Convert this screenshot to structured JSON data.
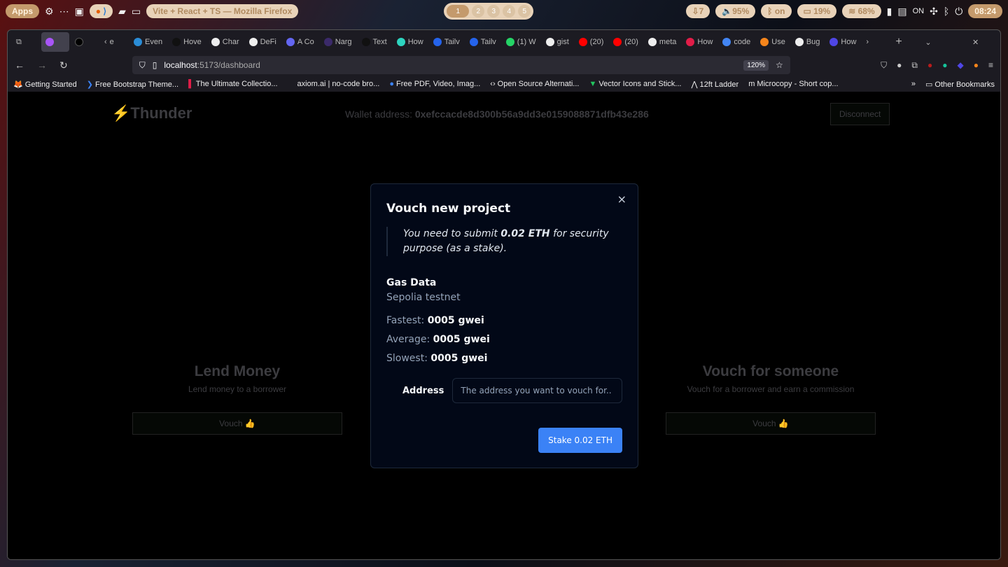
{
  "os": {
    "apps": "Apps",
    "window_title": "Vite + React + TS — Mozilla Firefox",
    "workspaces": [
      "1",
      "2",
      "3",
      "4",
      "5"
    ],
    "updates": "7",
    "volume": "95%",
    "bluetooth": "on",
    "battery": "19%",
    "wifi": "68%",
    "status_on": "ON",
    "clock": "08:24"
  },
  "browser": {
    "tabs": [
      "",
      "",
      "e",
      "Even",
      "Hove",
      "Char",
      "DeFi",
      "A Co",
      "Narg",
      "Text",
      "How",
      "Tailv",
      "Tailv",
      "(1) W",
      "gist",
      "(20)",
      "(20)",
      "meta",
      "How",
      "code",
      "Use",
      "Bug",
      "How"
    ],
    "url_host": "localhost",
    "url_path": ":5173/dashboard",
    "zoom": "120%",
    "bookmarks": [
      "Getting Started",
      "Free Bootstrap Theme...",
      "The Ultimate Collectio...",
      "axiom.ai | no-code bro...",
      "Free PDF, Video, Imag...",
      "Open Source Alternati...",
      "Vector Icons and Stick...",
      "12ft Ladder",
      "Microcopy - Short cop..."
    ],
    "other_bookmarks": "Other Bookmarks"
  },
  "app": {
    "logo": "Thunder",
    "wallet_label": "Wallet address:",
    "wallet": "0xefccacde8d300b56a9dd3e0159088871dfb43e286",
    "disconnect": "Disconnect",
    "cards": [
      {
        "title": "Lend Money",
        "desc": "Lend money to a borrower",
        "button": "Vouch 👍"
      },
      {
        "title": "Vouch for someone",
        "desc": "Vouch for a borrower and earn a commission",
        "button": "Vouch 👍"
      }
    ]
  },
  "modal": {
    "title": "Vouch new project",
    "note_pre": "You need to submit ",
    "note_bold": "0.02 ETH",
    "note_post": " for security purpose (as a stake).",
    "gas_title": "Gas Data",
    "network": "Sepolia testnet",
    "rows": [
      {
        "label": "Fastest: ",
        "value": "0005 gwei"
      },
      {
        "label": "Average: ",
        "value": "0005 gwei"
      },
      {
        "label": "Slowest: ",
        "value": "0005 gwei"
      }
    ],
    "address_label": "Address",
    "address_placeholder": "The address you want to vouch for..",
    "address_value": "",
    "submit": "Stake 0.02 ETH",
    "close": "×"
  },
  "colors": {
    "accent": "#3b82f6",
    "modal_bg": "#020817"
  }
}
